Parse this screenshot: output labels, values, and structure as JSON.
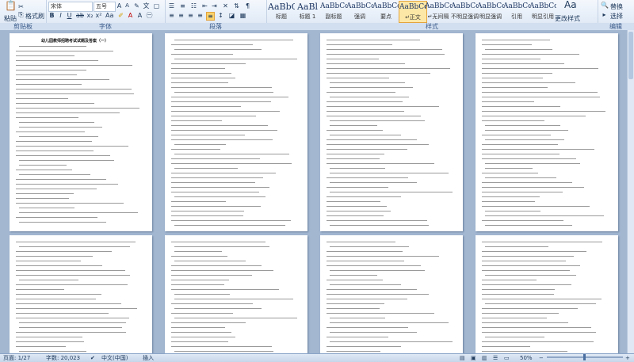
{
  "ribbon": {
    "clipboard": {
      "label": "剪贴板",
      "paste": "粘贴",
      "format_painter": "格式刷"
    },
    "font": {
      "label": "字体",
      "font_name": "宋体",
      "font_size": "五号"
    },
    "paragraph": {
      "label": "段落"
    },
    "styles": {
      "label": "样式",
      "items": [
        {
          "preview": "AaBbC",
          "name": "标题"
        },
        {
          "preview": "AaBl",
          "name": "标题 1"
        },
        {
          "preview": "AaBbCcD",
          "name": "副标题"
        },
        {
          "preview": "AaBbCcD",
          "name": "强调"
        },
        {
          "preview": "AaBbCcD",
          "name": "要点"
        },
        {
          "preview": "AaBbCcDc",
          "name": "↵正文"
        },
        {
          "preview": "AaBbCcDc",
          "name": "↵无间隔"
        },
        {
          "preview": "AaBbCcDc",
          "name": "不明显强调"
        },
        {
          "preview": "AaBbCcDc",
          "name": "明显强调"
        },
        {
          "preview": "AaBbCcDc",
          "name": "引用"
        },
        {
          "preview": "AaBbCcDc",
          "name": "明显引用"
        }
      ],
      "change_styles": "更改样式"
    },
    "editing": {
      "label": "编辑",
      "replace": "替换",
      "select": "选择"
    }
  },
  "document": {
    "first_page_title": "幼儿园教师招聘考试试题及答案（一）"
  },
  "status": {
    "page": "页面: 1/27",
    "words": "字数: 20,023",
    "language": "中文(中国)",
    "mode": "插入",
    "zoom": "50%"
  },
  "colors": {
    "ribbon_bg": "#dbe6f4",
    "doc_bg": "#a3b7d1",
    "accent": "#e3a33e"
  }
}
